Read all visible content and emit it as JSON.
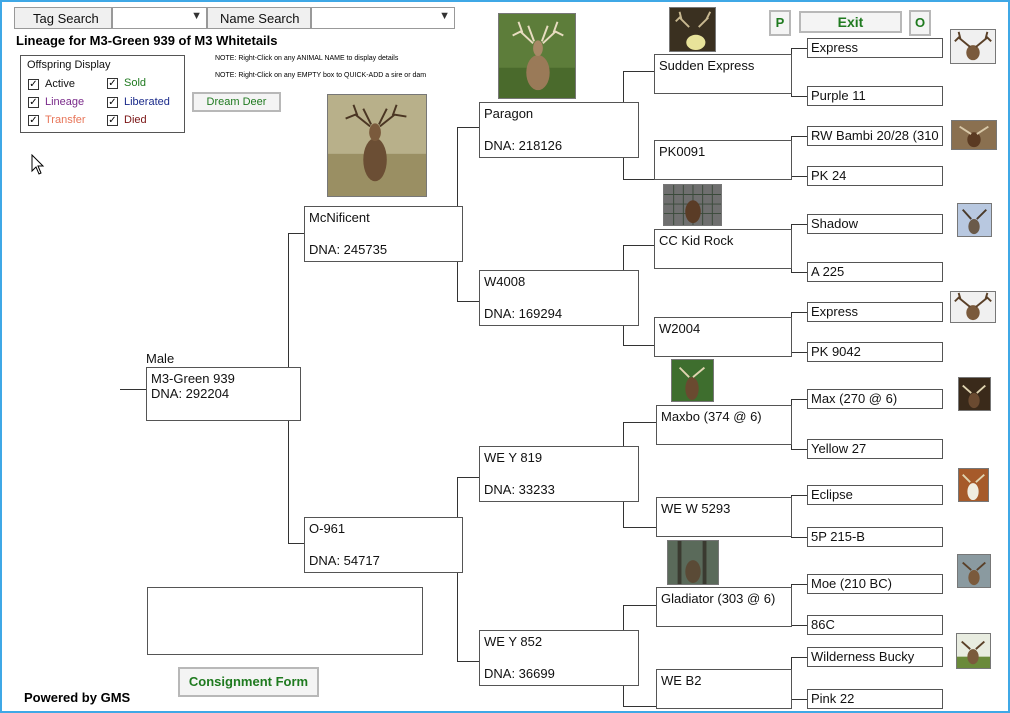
{
  "toolbar": {
    "tag_search": "Tag Search",
    "name_search": "Name Search",
    "p_label": "P",
    "exit_label": "Exit",
    "o_label": "O"
  },
  "page_title": "Lineage for M3-Green 939 of M3 Whitetails",
  "notes": {
    "note1": "NOTE: Right-Click on any ANIMAL NAME to display details",
    "note2": "NOTE: Right-Click on any EMPTY box to QUICK-ADD a sire or dam"
  },
  "offspring_display": {
    "title": "Offspring Display",
    "items": [
      {
        "label": "Active",
        "color": "#111111",
        "checked": "✓"
      },
      {
        "label": "Sold",
        "color": "#1f7a1f",
        "checked": "✓"
      },
      {
        "label": "Lineage",
        "color": "#7a2a8a",
        "checked": "✓"
      },
      {
        "label": "Liberated",
        "color": "#1a2a8a",
        "checked": "✓"
      },
      {
        "label": "Transfer",
        "color": "#e8765a",
        "checked": "✓"
      },
      {
        "label": "Died",
        "color": "#7a1414",
        "checked": "✓"
      }
    ]
  },
  "dream_deer": "Dream Deer",
  "subject": {
    "sex": "Male",
    "name": "M3-Green 939",
    "dna": "DNA: 292204"
  },
  "gen1": {
    "sire": {
      "name": "McNificent",
      "dna": "DNA: 245735"
    },
    "dam": {
      "name": "O-961",
      "dna": "DNA: 54717"
    }
  },
  "gen2": [
    {
      "name": "Paragon",
      "dna": "DNA: 218126"
    },
    {
      "name": "W4008",
      "dna": "DNA: 169294"
    },
    {
      "name": "WE Y 819",
      "dna": "DNA: 33233"
    },
    {
      "name": "WE Y 852",
      "dna": "DNA: 36699"
    }
  ],
  "gen3": [
    {
      "name": "Sudden Express"
    },
    {
      "name": "PK0091"
    },
    {
      "name": "CC Kid Rock"
    },
    {
      "name": "W2004"
    },
    {
      "name": "Maxbo (374 @ 6)"
    },
    {
      "name": "WE W 5293"
    },
    {
      "name": "Gladiator (303 @ 6)"
    },
    {
      "name": "WE B2"
    }
  ],
  "gen4": [
    {
      "name": "Express"
    },
    {
      "name": "Purple 11"
    },
    {
      "name": "RW Bambi 20/28 (310"
    },
    {
      "name": "PK 24"
    },
    {
      "name": "Shadow"
    },
    {
      "name": "A 225"
    },
    {
      "name": "Express"
    },
    {
      "name": "PK 9042"
    },
    {
      "name": "Max (270 @ 6)"
    },
    {
      "name": "Yellow 27"
    },
    {
      "name": "Eclipse"
    },
    {
      "name": "5P 215-B"
    },
    {
      "name": "Moe (210 BC)"
    },
    {
      "name": "86C"
    },
    {
      "name": "Wilderness Bucky"
    },
    {
      "name": "Pink 22"
    }
  ],
  "consignment": "Consignment Form",
  "powered_by": "Powered by GMS",
  "colors": {
    "frame": "#3fa8e6",
    "button_green": "#1f7a1f"
  }
}
